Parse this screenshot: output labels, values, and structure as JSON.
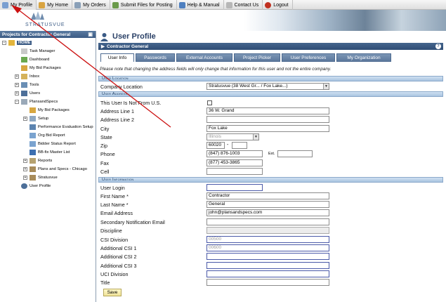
{
  "topbar": {
    "items": [
      {
        "label": "My Profile",
        "icon": "profile-icon",
        "color": "#7a9fd0"
      },
      {
        "label": "My Home",
        "icon": "home-icon",
        "color": "#d9a441"
      },
      {
        "label": "My Orders",
        "icon": "orders-icon",
        "color": "#8aa0b8"
      },
      {
        "label": "Submit Files for Posting",
        "icon": "upload-icon",
        "color": "#6a9a4a"
      },
      {
        "label": "Help & Manual",
        "icon": "help-icon",
        "color": "#4f80c0"
      },
      {
        "label": "Contact Us",
        "icon": "contact-icon",
        "color": "#b7b7b7"
      },
      {
        "label": "Logout",
        "icon": "logout-icon",
        "color": "#c03020"
      }
    ]
  },
  "brand": {
    "logo_text": "STRATUSVUE"
  },
  "sidebar": {
    "title": "Projects for Contractor General",
    "home_label": "HOME",
    "items": [
      {
        "label": "Task Manager"
      },
      {
        "label": "Dashboard"
      },
      {
        "label": "My Bid Packages"
      },
      {
        "label": "Inbox"
      },
      {
        "label": "Tools"
      },
      {
        "label": "Users"
      },
      {
        "label": "PlansandSpecs"
      },
      {
        "label": "My Bid Packages"
      },
      {
        "label": "Setup"
      },
      {
        "label": "Performance Evaluation Setup"
      },
      {
        "label": "Org Bid Report"
      },
      {
        "label": "Bidder Status Report"
      },
      {
        "label": "BB-fix Master List"
      },
      {
        "label": "Reports"
      },
      {
        "label": "Plans and Specs - Chicago"
      },
      {
        "label": "Stratusvue"
      },
      {
        "label": "User Profile"
      }
    ]
  },
  "page": {
    "title": "User Profile",
    "company": "Contractor General",
    "help_glyph": "?",
    "tabs": [
      "User Info",
      "Passwords",
      "External Accounts",
      "Project Picker",
      "User Preferences",
      "My Organization"
    ],
    "note": "Please note that changing the address fields will only change that information for this user and not the entire company."
  },
  "sections": {
    "location": "User Location",
    "address": "User Address",
    "information": "User Information"
  },
  "form": {
    "company_location_label": "Company Location",
    "company_location_value": "Stratusvue (38 West Gr... / Fox Lake...)",
    "not_us_label": "This User Is Not From U.S.",
    "address1_label": "Address Line 1",
    "address1_value": "36 W. Grand",
    "address2_label": "Address Line 2",
    "address2_value": "",
    "city_label": "City",
    "city_value": "Fox Lake",
    "state_label": "State",
    "state_value": "Illinois",
    "zip_label": "Zip",
    "zip_value": "60020",
    "zip_sep": "-",
    "zip_ext_value": "",
    "phone_label": "Phone",
    "phone_value": "(847) 876-1003",
    "ext_label": "Ext.",
    "ext_value": "",
    "fax_label": "Fax",
    "fax_value": "(877) 453-3865",
    "cell_label": "Cell",
    "cell_value": "",
    "login_label": "User Login",
    "login_value": "",
    "first_name_label": "First Name  *",
    "first_name_value": "Contractor",
    "last_name_label": "Last Name  *",
    "last_name_value": "General",
    "email_label": "Email Address",
    "email_value": "john@plansandspecs.com",
    "email2_label": "Secondary Notification Email",
    "email2_value": "",
    "discipline_label": "Discipline",
    "discipline_value": "",
    "csi_label": "CSI Division",
    "csi_value": "00500",
    "csi1_label": "Additional CSI 1",
    "csi1_value": "00600",
    "csi2_label": "Additional CSI 2",
    "csi2_value": "",
    "csi3_label": "Additional CSI 3",
    "csi3_value": "",
    "uci_label": "UCI Division",
    "uci_value": "",
    "title_label": "Title",
    "title_value": "",
    "save_label": "Save"
  },
  "colors": {
    "annotation_arrow": "#cc1111",
    "header_blue": "#2f4d75"
  }
}
